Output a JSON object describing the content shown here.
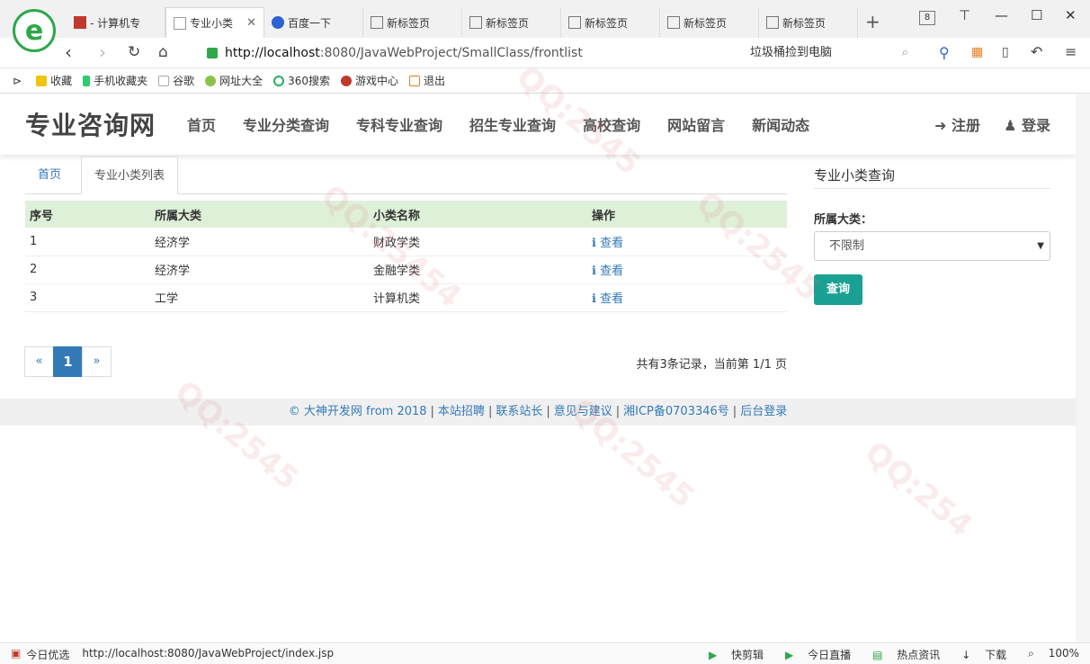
{
  "browser": {
    "tabs": [
      {
        "label": "- 计算机专",
        "icon_color": "#c0392b"
      },
      {
        "label": "专业小类",
        "close": "✕",
        "active": true
      },
      {
        "label": "百度一下",
        "icon_color": "#2d62d6"
      },
      {
        "label": "新标签页"
      },
      {
        "label": "新标签页"
      },
      {
        "label": "新标签页"
      },
      {
        "label": "新标签页"
      },
      {
        "label": "新标签页"
      }
    ],
    "tab_count": "8",
    "new_tab_icon": "+",
    "url_host": "http://localhost",
    "url_rest": ":8080/JavaWebProject/SmallClass/frontlist",
    "search_text": "垃圾桶捡到电脑",
    "bookmarks": [
      "收藏",
      "手机收藏夹",
      "谷歌",
      "网址大全",
      "360搜索",
      "游戏中心",
      "退出"
    ]
  },
  "site": {
    "brand": "专业咨询网",
    "nav": [
      "首页",
      "专业分类查询",
      "专科专业查询",
      "招生专业查询",
      "高校查询",
      "网站留言",
      "新闻动态"
    ],
    "register": "注册",
    "login": "登录"
  },
  "breadcrumb": {
    "home": "首页",
    "current": "专业小类列表"
  },
  "table": {
    "headers": [
      "序号",
      "所属大类",
      "小类名称",
      "操作"
    ],
    "rows": [
      {
        "no": "1",
        "major": "经济学",
        "minor": "财政学类",
        "action": "查看"
      },
      {
        "no": "2",
        "major": "经济学",
        "minor": "金融学类",
        "action": "查看"
      },
      {
        "no": "3",
        "major": "工学",
        "minor": "计算机类",
        "action": "查看"
      }
    ]
  },
  "pager": {
    "prev": "«",
    "current": "1",
    "next": "»",
    "info": "共有3条记录，当前第 1/1 页"
  },
  "sidebar": {
    "title": "专业小类查询",
    "label": "所属大类：",
    "select_value": "不限制",
    "button": "查询"
  },
  "footer": {
    "copyright": "© 大神开发网 from 2018",
    "links": [
      "本站招聘",
      "联系站长",
      "意见与建议",
      "湘ICP备0703346号",
      "后台登录"
    ]
  },
  "statusbar": {
    "left_label": "今日优选",
    "url": "http://localhost:8080/JavaWebProject/index.jsp",
    "right": [
      "快剪辑",
      "今日直播",
      "热点资讯",
      "下载",
      "100%"
    ]
  },
  "colors": {
    "accent": "#337ab7",
    "table_head": "#dff0d8",
    "button": "#1aa194"
  }
}
